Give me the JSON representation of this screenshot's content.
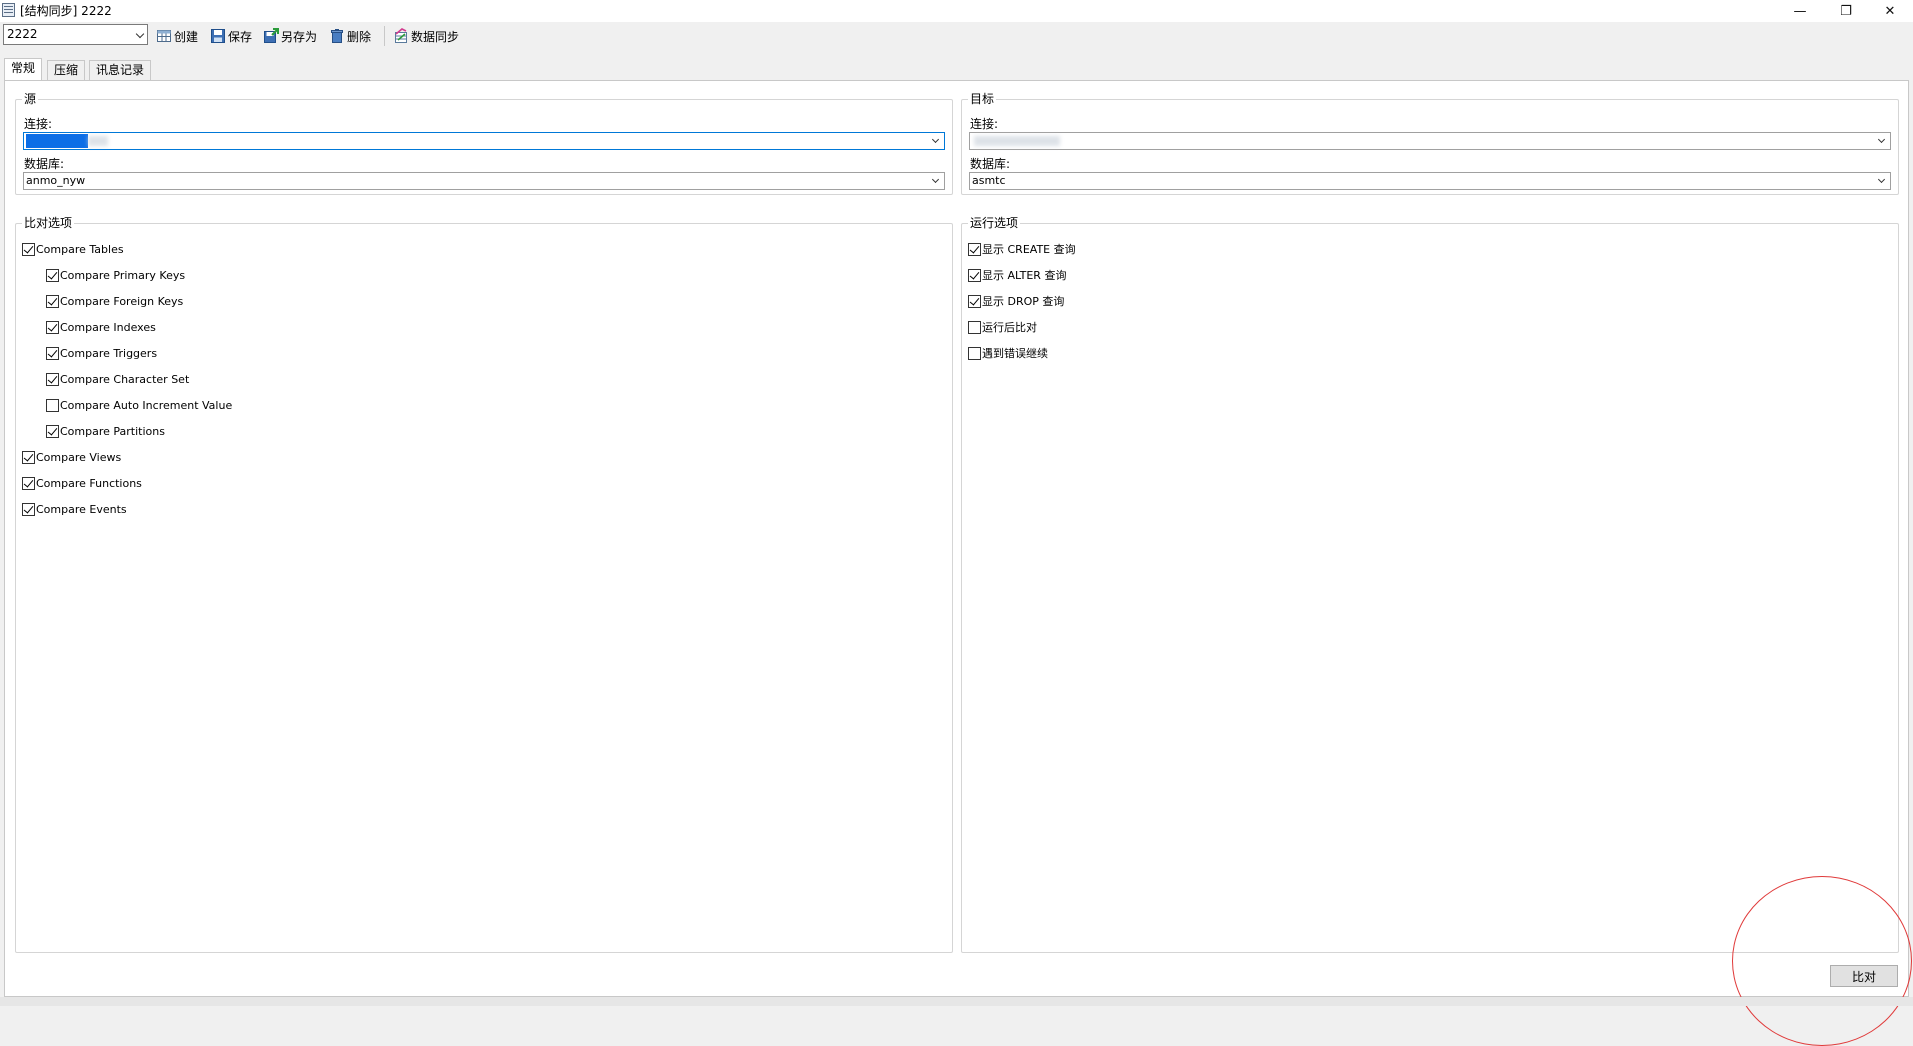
{
  "window": {
    "title": "[结构同步] 2222",
    "minimize_glyph": "—",
    "restore_glyph": "❐",
    "close_glyph": "✕"
  },
  "toolbar": {
    "profile_value": "2222",
    "create_label": "创建",
    "save_label": "保存",
    "save_as_label": "另存为",
    "delete_label": "删除",
    "data_sync_label": "数据同步"
  },
  "tabs": [
    {
      "label": "常规",
      "active": true
    },
    {
      "label": "压缩",
      "active": false
    },
    {
      "label": "讯息记录",
      "active": false
    }
  ],
  "source": {
    "legend": "源",
    "connection_label": "连接:",
    "connection_value": "",
    "database_label": "数据库:",
    "database_value": "anmo_nyw"
  },
  "target": {
    "legend": "目标",
    "connection_label": "连接:",
    "connection_value": "",
    "database_label": "数据库:",
    "database_value": "asmtc"
  },
  "compare_options": {
    "legend": "比对选项",
    "items": [
      {
        "label": "Compare Tables",
        "checked": true,
        "level": 0
      },
      {
        "label": "Compare Primary Keys",
        "checked": true,
        "level": 1
      },
      {
        "label": "Compare Foreign Keys",
        "checked": true,
        "level": 1
      },
      {
        "label": "Compare Indexes",
        "checked": true,
        "level": 1
      },
      {
        "label": "Compare Triggers",
        "checked": true,
        "level": 1
      },
      {
        "label": "Compare Character Set",
        "checked": true,
        "level": 1
      },
      {
        "label": "Compare Auto Increment Value",
        "checked": false,
        "level": 1
      },
      {
        "label": "Compare Partitions",
        "checked": true,
        "level": 1
      },
      {
        "label": "Compare Views",
        "checked": true,
        "level": 0
      },
      {
        "label": "Compare Functions",
        "checked": true,
        "level": 0
      },
      {
        "label": "Compare Events",
        "checked": true,
        "level": 0
      }
    ]
  },
  "run_options": {
    "legend": "运行选项",
    "items": [
      {
        "label": "显示 CREATE 查询",
        "checked": true
      },
      {
        "label": "显示 ALTER 查询",
        "checked": true
      },
      {
        "label": "显示 DROP 查询",
        "checked": true
      },
      {
        "label": "运行后比对",
        "checked": false
      },
      {
        "label": "遇到错误继续",
        "checked": false
      }
    ]
  },
  "footer": {
    "compare_button_label": "比对"
  },
  "colors": {
    "accent": "#0078d7",
    "annotation_circle": "#e03a3a"
  }
}
